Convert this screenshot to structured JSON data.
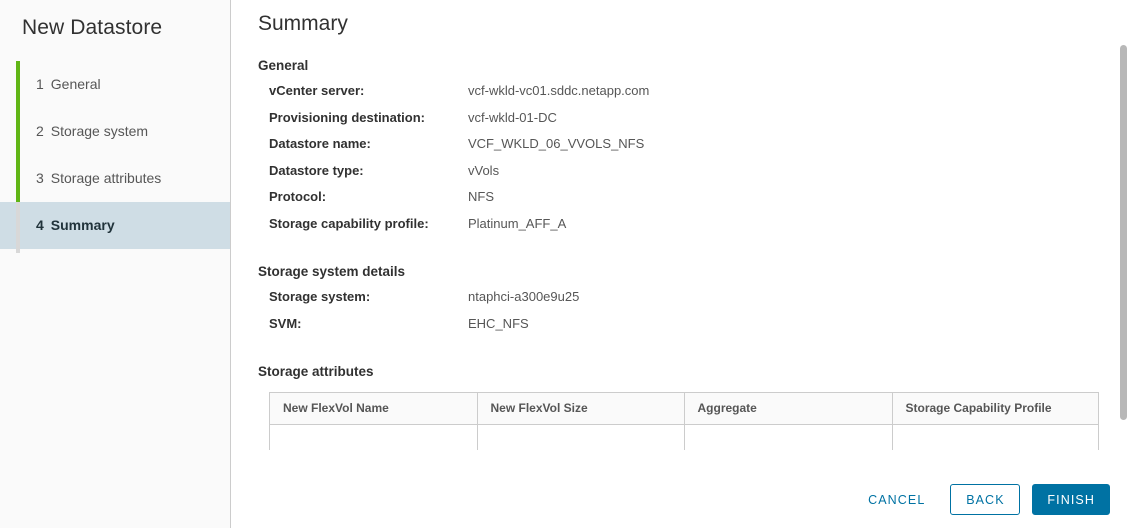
{
  "wizard": {
    "title": "New Datastore",
    "steps": [
      {
        "num": "1",
        "label": "General",
        "active": false
      },
      {
        "num": "2",
        "label": "Storage system",
        "active": false
      },
      {
        "num": "3",
        "label": "Storage attributes",
        "active": false
      },
      {
        "num": "4",
        "label": "Summary",
        "active": true
      }
    ]
  },
  "page": {
    "title": "Summary"
  },
  "general": {
    "heading": "General",
    "rows": [
      {
        "key": "vCenter server:",
        "value": "vcf-wkld-vc01.sddc.netapp.com"
      },
      {
        "key": "Provisioning destination:",
        "value": "vcf-wkld-01-DC"
      },
      {
        "key": "Datastore name:",
        "value": "VCF_WKLD_06_VVOLS_NFS"
      },
      {
        "key": "Datastore type:",
        "value": "vVols"
      },
      {
        "key": "Protocol:",
        "value": "NFS"
      },
      {
        "key": "Storage capability profile:",
        "value": "Platinum_AFF_A"
      }
    ]
  },
  "storage_system_details": {
    "heading": "Storage system details",
    "rows": [
      {
        "key": "Storage system:",
        "value": "ntaphci-a300e9u25"
      },
      {
        "key": "SVM:",
        "value": "EHC_NFS"
      }
    ]
  },
  "storage_attributes": {
    "heading": "Storage attributes",
    "table": {
      "columns": [
        "New FlexVol Name",
        "New FlexVol Size",
        "Aggregate",
        "Storage Capability Profile"
      ],
      "rows": []
    }
  },
  "footer": {
    "cancel_label": "CANCEL",
    "back_label": "BACK",
    "finish_label": "FINISH"
  },
  "colors": {
    "accent": "#0072a3",
    "progress_complete": "#60b515",
    "progress_remaining": "#d8d8d8",
    "active_step_bg": "#cfdde5",
    "sidebar_bg": "#fafafa",
    "border": "#cccccc"
  }
}
